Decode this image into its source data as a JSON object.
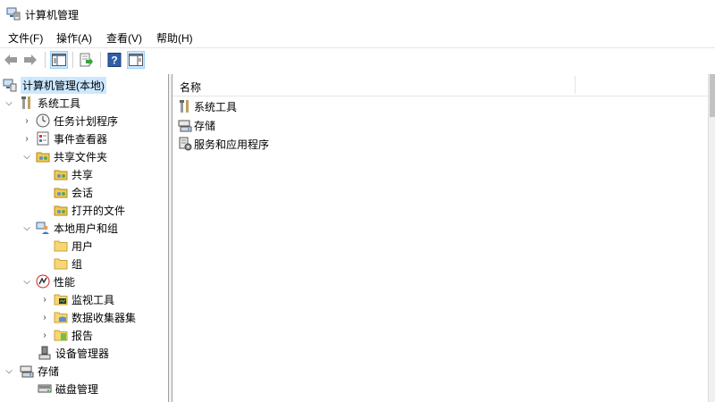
{
  "window": {
    "title": "计算机管理"
  },
  "menu": [
    "文件(F)",
    "操作(A)",
    "查看(V)",
    "帮助(H)"
  ],
  "toolbar": {
    "icons": [
      "back-icon",
      "forward-icon",
      "show-hide-console-tree-icon",
      "export-list-icon",
      "help-icon",
      "show-hide-action-pane-icon"
    ]
  },
  "tree": {
    "root": "计算机管理(本地)",
    "system_tools": "系统工具",
    "task_scheduler": "任务计划程序",
    "event_viewer": "事件查看器",
    "shared_folders": "共享文件夹",
    "shares": "共享",
    "sessions": "会话",
    "open_files": "打开的文件",
    "local_users_groups": "本地用户和组",
    "users": "用户",
    "groups": "组",
    "performance": "性能",
    "monitoring_tools": "监视工具",
    "data_collector_sets": "数据收集器集",
    "reports": "报告",
    "device_manager": "设备管理器",
    "storage": "存储",
    "disk_management": "磁盘管理"
  },
  "list": {
    "column_name": "名称",
    "items": [
      "系统工具",
      "存储",
      "服务和应用程序"
    ]
  }
}
